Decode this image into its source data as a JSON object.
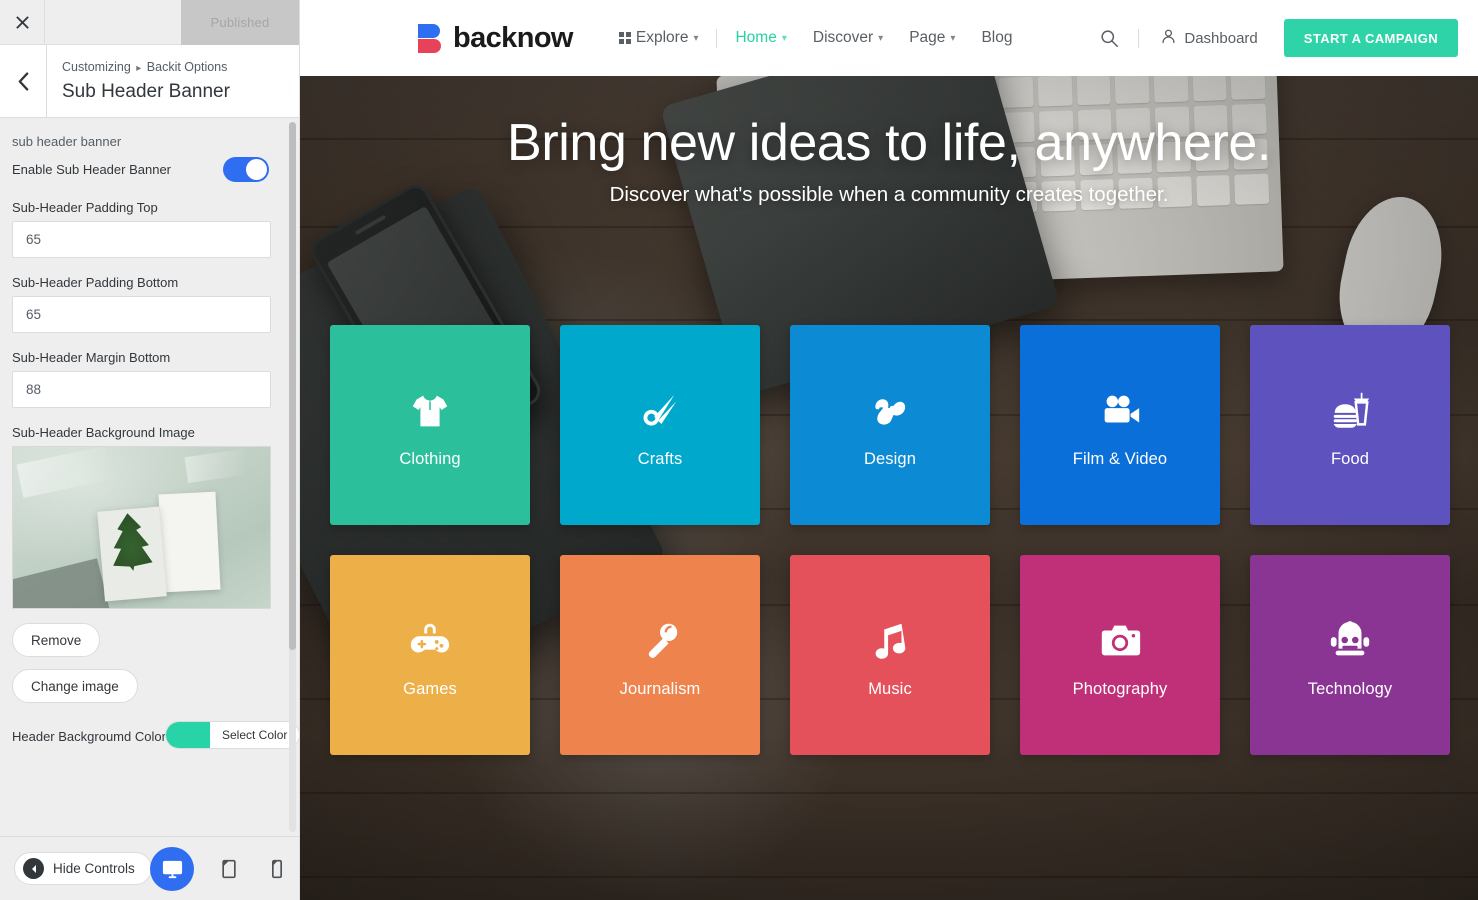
{
  "customizer": {
    "close_icon": "close-icon",
    "published_label": "Published",
    "back_icon": "chevron-left-icon",
    "breadcrumb_root": "Customizing",
    "breadcrumb_sep": "▸",
    "breadcrumb_parent": "Backit Options",
    "panel_title": "Sub Header Banner",
    "section_label": "sub header banner",
    "enable_toggle": {
      "label": "Enable Sub Header Banner",
      "state": "on",
      "color": "#2f6ef0"
    },
    "fields": [
      {
        "label": "Sub-Header Padding Top",
        "value": "65",
        "name": "padding-top-input"
      },
      {
        "label": "Sub-Header Padding Bottom",
        "value": "65",
        "name": "padding-bottom-input"
      },
      {
        "label": "Sub-Header Margin Bottom",
        "value": "88",
        "name": "margin-bottom-input"
      }
    ],
    "image_field": {
      "label": "Sub-Header Background Image",
      "remove_label": "Remove",
      "change_label": "Change image"
    },
    "color_field": {
      "label": "Header Backgroumd Color",
      "button_label": "Select Color",
      "swatch_color": "#28d3a7"
    },
    "footer": {
      "hide_controls_label": "Hide Controls",
      "devices": [
        {
          "name": "desktop-preview-button",
          "icon": "desktop-icon",
          "active": true
        },
        {
          "name": "tablet-preview-button",
          "icon": "tablet-icon",
          "active": false
        },
        {
          "name": "mobile-preview-button",
          "icon": "mobile-icon",
          "active": false
        }
      ]
    }
  },
  "site": {
    "brand": {
      "name": "backnow",
      "mark_colors": [
        "#2f6ef0",
        "#e8415a"
      ]
    },
    "nav": [
      {
        "label": "Explore",
        "icon": "grid-icon",
        "caret": true,
        "active": false
      },
      {
        "label": "Home",
        "icon": "",
        "caret": true,
        "active": true
      },
      {
        "label": "Discover",
        "icon": "",
        "caret": true,
        "active": false
      },
      {
        "label": "Page",
        "icon": "",
        "caret": true,
        "active": false
      },
      {
        "label": "Blog",
        "icon": "",
        "caret": false,
        "active": false
      }
    ],
    "nav_right": {
      "search_icon": "search-icon",
      "dashboard_label": "Dashboard",
      "dashboard_icon": "user-icon",
      "cta_label": "START A CAMPAIGN",
      "cta_color": "#2ed3a8"
    },
    "hero": {
      "title": "Bring new ideas to life, anywhere.",
      "subtitle": "Discover what's possible when a community creates together."
    },
    "categories": [
      {
        "label": "Clothing",
        "color": "#2bbf9c",
        "icon": "tshirt-icon"
      },
      {
        "label": "Crafts",
        "color": "#00a8cc",
        "icon": "scissors-icon"
      },
      {
        "label": "Design",
        "color": "#0c8bd4",
        "icon": "pen-squiggle-icon"
      },
      {
        "label": "Film & Video",
        "color": "#0a6fd8",
        "icon": "movie-camera-icon"
      },
      {
        "label": "Food",
        "color": "#5d52be",
        "icon": "burger-drink-icon"
      },
      {
        "label": "Games",
        "color": "#edb048",
        "icon": "gamepad-icon"
      },
      {
        "label": "Journalism",
        "color": "#ee834e",
        "icon": "microphone-icon"
      },
      {
        "label": "Music",
        "color": "#e5515b",
        "icon": "music-note-icon"
      },
      {
        "label": "Photography",
        "color": "#bf3078",
        "icon": "camera-icon"
      },
      {
        "label": "Technology",
        "color": "#8a3494",
        "icon": "robot-icon"
      }
    ]
  }
}
